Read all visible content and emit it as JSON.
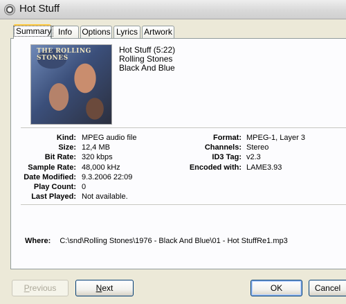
{
  "window": {
    "title": "Hot Stuff"
  },
  "tabs": [
    {
      "label": "Summary",
      "active": true
    },
    {
      "label": "Info"
    },
    {
      "label": "Options"
    },
    {
      "label": "Lyrics"
    },
    {
      "label": "Artwork"
    }
  ],
  "artwork": {
    "band_text": "THE ROLLING STONES"
  },
  "track": {
    "title_line": "Hot Stuff (5:22)",
    "artist": "Rolling Stones",
    "album": "Black And Blue"
  },
  "details_left": [
    {
      "label": "Kind:",
      "value": "MPEG audio file"
    },
    {
      "label": "Size:",
      "value": "12,4 MB"
    },
    {
      "label": "Bit Rate:",
      "value": "320 kbps"
    },
    {
      "label": "Sample Rate:",
      "value": "48,000 kHz"
    },
    {
      "label": "Date Modified:",
      "value": "9.3.2006 22:09"
    },
    {
      "label": "Play Count:",
      "value": "0"
    },
    {
      "label": "Last Played:",
      "value": "Not available."
    }
  ],
  "details_right": [
    {
      "label": "Format:",
      "value": "MPEG-1, Layer 3"
    },
    {
      "label": "Channels:",
      "value": "Stereo"
    },
    {
      "label": "ID3 Tag:",
      "value": "v2.3"
    },
    {
      "label": "Encoded with:",
      "value": "LAME3.93"
    }
  ],
  "where": {
    "label": "Where:",
    "value": "C:\\snd\\Rolling Stones\\1976 - Black And Blue\\01 - Hot StuffRe1.mp3"
  },
  "buttons": {
    "previous": "Previous",
    "next": "Next",
    "ok": "OK",
    "cancel": "Cancel"
  }
}
